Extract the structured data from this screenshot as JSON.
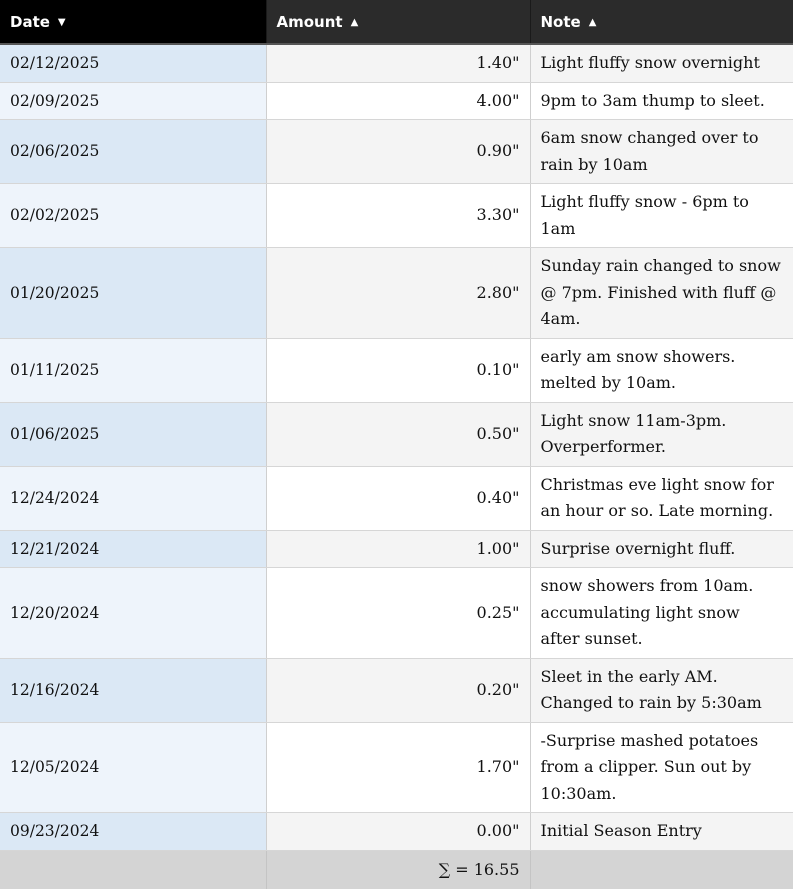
{
  "table": {
    "headers": {
      "date": "Date",
      "amount": "Amount",
      "note": "Note"
    },
    "sort_icons": {
      "date": "caret-down-icon",
      "amount": "caret-up-icon",
      "note": "caret-up-icon"
    },
    "rows": [
      {
        "date": "02/12/2025",
        "amount": "1.40\"",
        "note": "Light fluffy snow overnight"
      },
      {
        "date": "02/09/2025",
        "amount": "4.00\"",
        "note": "9pm to 3am thump to sleet."
      },
      {
        "date": "02/06/2025",
        "amount": "0.90\"",
        "note": "6am snow changed over to rain by 10am"
      },
      {
        "date": "02/02/2025",
        "amount": "3.30\"",
        "note": "Light fluffy snow - 6pm to 1am"
      },
      {
        "date": "01/20/2025",
        "amount": "2.80\"",
        "note": "Sunday rain changed to snow @ 7pm. Finished with fluff @ 4am."
      },
      {
        "date": "01/11/2025",
        "amount": "0.10\"",
        "note": "early am snow showers. melted by 10am."
      },
      {
        "date": "01/06/2025",
        "amount": "0.50\"",
        "note": "Light snow 11am-3pm. Overperformer."
      },
      {
        "date": "12/24/2024",
        "amount": "0.40\"",
        "note": "Christmas eve light snow for an hour or so. Late morning."
      },
      {
        "date": "12/21/2024",
        "amount": "1.00\"",
        "note": "Surprise overnight fluff."
      },
      {
        "date": "12/20/2024",
        "amount": "0.25\"",
        "note": "snow showers from 10am. accumulating light snow after sunset."
      },
      {
        "date": "12/16/2024",
        "amount": "0.20\"",
        "note": "Sleet in the early AM. Changed to rain by 5:30am"
      },
      {
        "date": "12/05/2024",
        "amount": "1.70\"",
        "note": "-Surprise mashed potatoes from a clipper. Sun out by 10:30am."
      },
      {
        "date": "09/23/2024",
        "amount": "0.00\"",
        "note": "Initial Season Entry"
      }
    ],
    "footer": {
      "total": "∑ = 16.55"
    }
  }
}
